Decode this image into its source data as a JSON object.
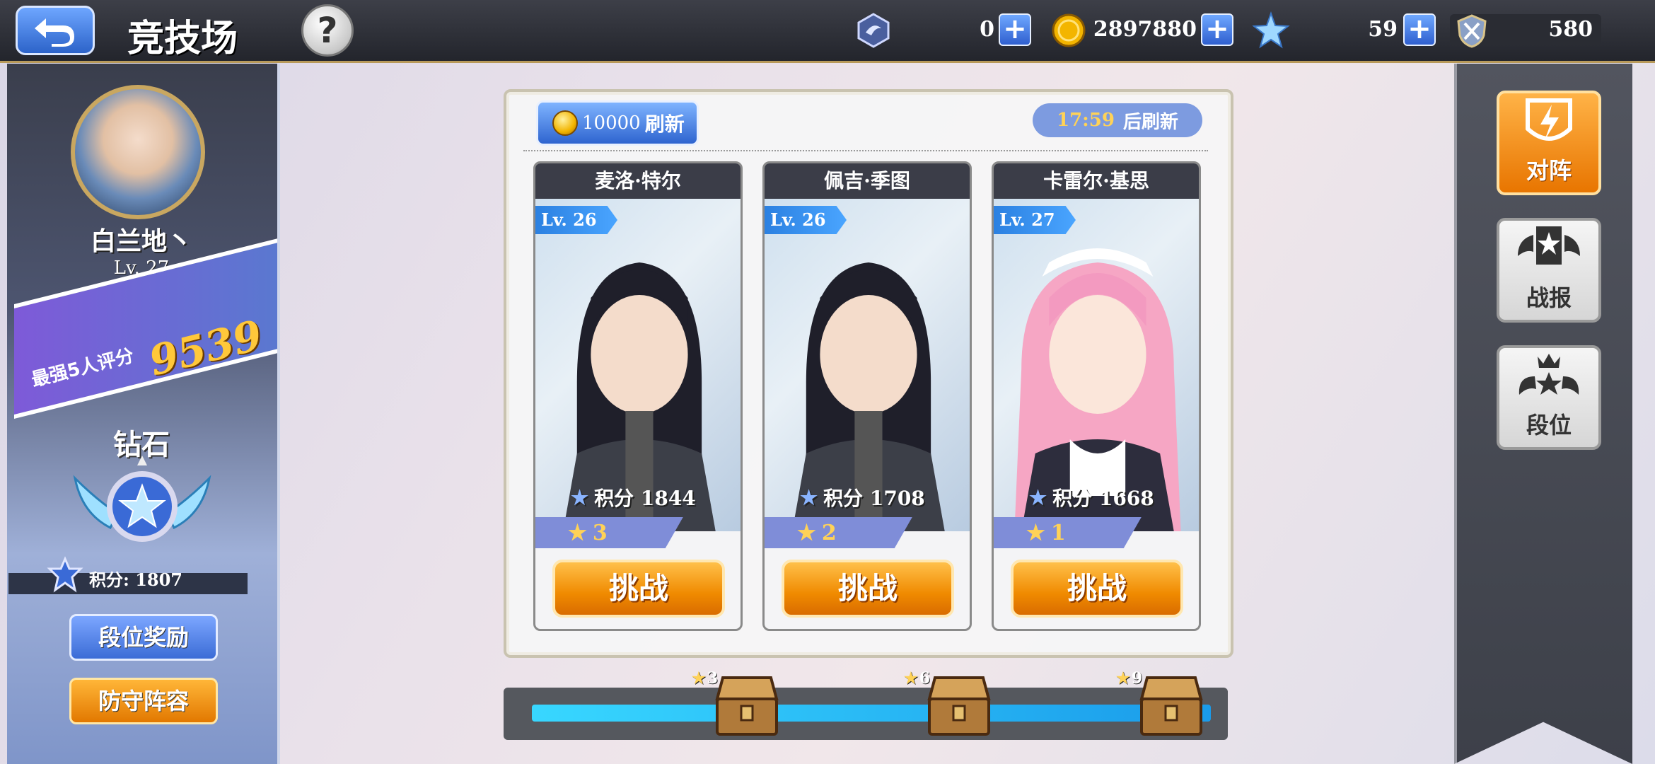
{
  "header": {
    "title": "竞技场",
    "help_label": "?"
  },
  "currencies": [
    {
      "name": "gem",
      "value": "0",
      "icon": "crystal-icon"
    },
    {
      "name": "gold",
      "value": "2897880",
      "icon": "gold-coin-icon"
    },
    {
      "name": "star",
      "value": "59",
      "icon": "star-crystal-icon"
    },
    {
      "name": "honor",
      "value": "580",
      "icon": "crossed-swords-shield-icon"
    }
  ],
  "player": {
    "name": "白兰地丶",
    "level": "Lv. 27",
    "rating_label": "最强5人评分",
    "rating_value": "9539",
    "rank_name": "钻石",
    "score_text": "积分: 1807"
  },
  "left_buttons": {
    "rank_reward": "段位奖励",
    "defense_lineup": "防守阵容"
  },
  "refresh": {
    "cost": "10000",
    "label": "刷新",
    "timer": "17:59",
    "timer_label": "后刷新"
  },
  "opponents": [
    {
      "name": "麦洛·特尔",
      "level": "Lv. 26",
      "score": "积分  1844",
      "stars": "3",
      "button": "挑战"
    },
    {
      "name": "佩吉·季图",
      "level": "Lv. 26",
      "score": "积分  1708",
      "stars": "2",
      "button": "挑战"
    },
    {
      "name": "卡雷尔·基思",
      "level": "Lv. 27",
      "score": "积分  1668",
      "stars": "1",
      "button": "挑战"
    }
  ],
  "progress": {
    "chests": [
      {
        "stars_required": "3"
      },
      {
        "stars_required": "6"
      },
      {
        "stars_required": "9"
      }
    ]
  },
  "right_buttons": {
    "formation": "对阵",
    "battle_report": "战报",
    "rank_position": "段位"
  },
  "colors": {
    "accent_blue": "#3b6cd6",
    "accent_orange": "#f08a00",
    "gold_text": "#ffc83a"
  }
}
